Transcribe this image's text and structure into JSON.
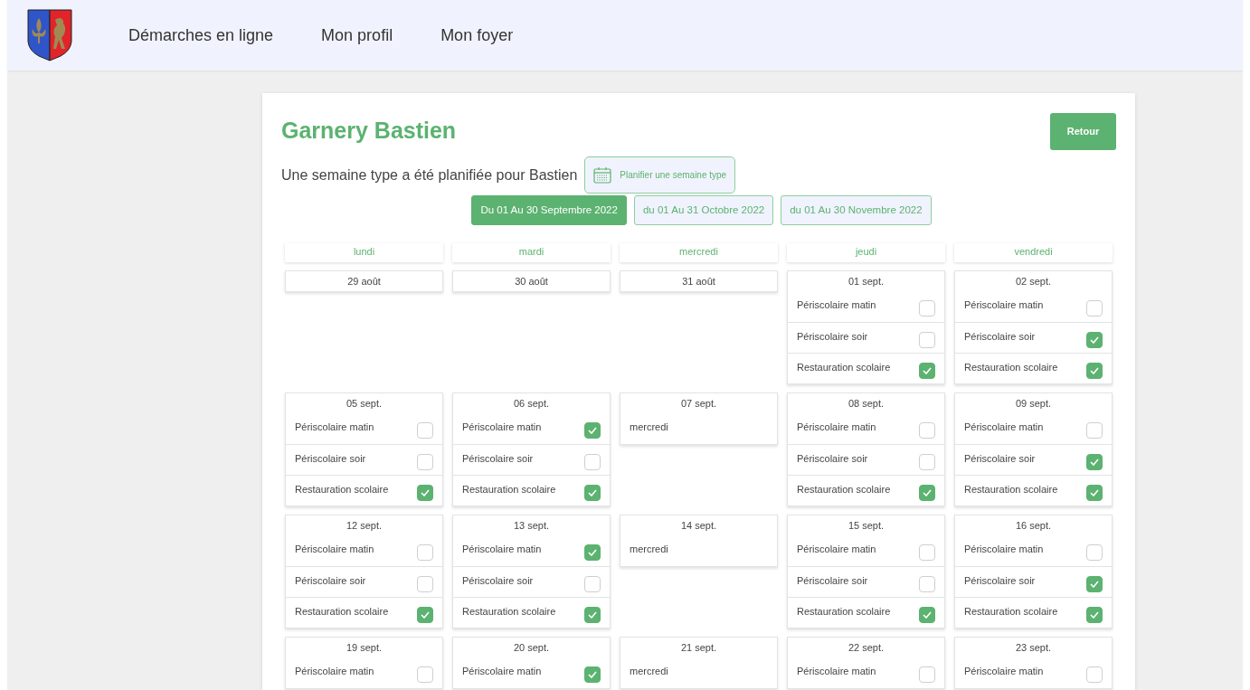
{
  "nav": {
    "items": [
      {
        "label": "Démarches en ligne"
      },
      {
        "label": "Mon profil"
      },
      {
        "label": "Mon foyer"
      }
    ]
  },
  "page": {
    "title": "Garnery Bastien",
    "back_button": "Retour",
    "summary": "Une semaine type a été planifiée pour Bastien",
    "plan_button": "Planifier une semaine type"
  },
  "periods": [
    {
      "label": "Du 01 Au 30 Septembre 2022",
      "selected": true
    },
    {
      "label": "du 01 Au 31 Octobre 2022",
      "selected": false
    },
    {
      "label": "du 01 Au 30 Novembre 2022",
      "selected": false
    }
  ],
  "weekdays": [
    "lundi",
    "mardi",
    "mercredi",
    "jeudi",
    "vendredi"
  ],
  "weeks": [
    [
      {
        "date": "29 août"
      },
      {
        "date": "30 août"
      },
      {
        "date": "31 août"
      },
      {
        "date": "01 sept.",
        "activities": [
          {
            "label": "Périscolaire matin",
            "checked": false
          },
          {
            "label": "Périscolaire soir",
            "checked": false
          },
          {
            "label": "Restauration scolaire",
            "checked": true
          }
        ]
      },
      {
        "date": "02 sept.",
        "activities": [
          {
            "label": "Périscolaire matin",
            "checked": false
          },
          {
            "label": "Périscolaire soir",
            "checked": true
          },
          {
            "label": "Restauration scolaire",
            "checked": true
          }
        ]
      }
    ],
    [
      {
        "date": "05 sept.",
        "activities": [
          {
            "label": "Périscolaire matin",
            "checked": false
          },
          {
            "label": "Périscolaire soir",
            "checked": false
          },
          {
            "label": "Restauration scolaire",
            "checked": true
          }
        ]
      },
      {
        "date": "06 sept.",
        "activities": [
          {
            "label": "Périscolaire matin",
            "checked": true
          },
          {
            "label": "Périscolaire soir",
            "checked": false
          },
          {
            "label": "Restauration scolaire",
            "checked": true
          }
        ]
      },
      {
        "date": "07 sept.",
        "note": "mercredi"
      },
      {
        "date": "08 sept.",
        "activities": [
          {
            "label": "Périscolaire matin",
            "checked": false
          },
          {
            "label": "Périscolaire soir",
            "checked": false
          },
          {
            "label": "Restauration scolaire",
            "checked": true
          }
        ]
      },
      {
        "date": "09 sept.",
        "activities": [
          {
            "label": "Périscolaire matin",
            "checked": false
          },
          {
            "label": "Périscolaire soir",
            "checked": true
          },
          {
            "label": "Restauration scolaire",
            "checked": true
          }
        ]
      }
    ],
    [
      {
        "date": "12 sept.",
        "activities": [
          {
            "label": "Périscolaire matin",
            "checked": false
          },
          {
            "label": "Périscolaire soir",
            "checked": false
          },
          {
            "label": "Restauration scolaire",
            "checked": true
          }
        ]
      },
      {
        "date": "13 sept.",
        "activities": [
          {
            "label": "Périscolaire matin",
            "checked": true
          },
          {
            "label": "Périscolaire soir",
            "checked": false
          },
          {
            "label": "Restauration scolaire",
            "checked": true
          }
        ]
      },
      {
        "date": "14 sept.",
        "note": "mercredi"
      },
      {
        "date": "15 sept.",
        "activities": [
          {
            "label": "Périscolaire matin",
            "checked": false
          },
          {
            "label": "Périscolaire soir",
            "checked": false
          },
          {
            "label": "Restauration scolaire",
            "checked": true
          }
        ]
      },
      {
        "date": "16 sept.",
        "activities": [
          {
            "label": "Périscolaire matin",
            "checked": false
          },
          {
            "label": "Périscolaire soir",
            "checked": true
          },
          {
            "label": "Restauration scolaire",
            "checked": true
          }
        ]
      }
    ],
    [
      {
        "date": "19 sept.",
        "activities": [
          {
            "label": "Périscolaire matin",
            "checked": false
          }
        ]
      },
      {
        "date": "20 sept.",
        "activities": [
          {
            "label": "Périscolaire matin",
            "checked": true
          }
        ]
      },
      {
        "date": "21 sept.",
        "note": "mercredi"
      },
      {
        "date": "22 sept.",
        "activities": [
          {
            "label": "Périscolaire matin",
            "checked": false
          }
        ]
      },
      {
        "date": "23 sept.",
        "activities": [
          {
            "label": "Périscolaire matin",
            "checked": false
          }
        ]
      }
    ]
  ]
}
